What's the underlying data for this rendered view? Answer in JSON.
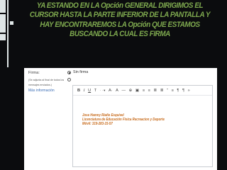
{
  "slide": {
    "title": "YA ESTANDO EN LA Opción GENERAL DIRIGIMOS EL CURSOR HASTA LA PARTE INFERIOR DE LA PANTALLA Y HAY ENCONTRAREMOS LA Opción   QUE ESTAMOS BUSCANDO LA CUAL ES FIRMA",
    "title_color": "#7faa4f",
    "background": "#0b0c0e"
  },
  "firma": {
    "label": "Firma:",
    "hint": "(Se adjunta al final de todos los mensajes enviados.)",
    "more_info": "Más información",
    "options": [
      {
        "label": "Sin firma",
        "selected": true
      },
      {
        "label": "",
        "selected": false
      }
    ]
  },
  "toolbar": {
    "buttons": [
      {
        "name": "bold-button",
        "text": "B",
        "style": "b"
      },
      {
        "name": "italic-button",
        "text": "I",
        "style": "i"
      },
      {
        "name": "underline-button",
        "text": "U",
        "style": "u"
      },
      {
        "name": "font-family-button",
        "text": "T",
        "style": ""
      },
      {
        "name": "font-size-dropdown-button",
        "text": "· · ▾",
        "style": "sm"
      },
      {
        "name": "font-size-button",
        "text": "A·",
        "style": ""
      },
      {
        "name": "text-color-button",
        "text": "A",
        "style": ""
      },
      {
        "name": "highlight-color-button",
        "text": "—",
        "style": ""
      },
      {
        "name": "link-button",
        "text": "⊕",
        "style": ""
      },
      {
        "name": "image-button",
        "text": "▣",
        "style": ""
      },
      {
        "name": "numbered-list-button",
        "text": "≡",
        "style": ""
      },
      {
        "name": "bullet-list-button",
        "text": "≡",
        "style": ""
      },
      {
        "name": "indent-less-button",
        "text": "≣",
        "style": ""
      },
      {
        "name": "indent-more-button",
        "text": "≣",
        "style": ""
      },
      {
        "name": "quote-button",
        "text": "”",
        "style": ""
      },
      {
        "name": "align-button",
        "text": "≡",
        "style": ""
      },
      {
        "name": "rtl-button",
        "text": "¶",
        "style": ""
      },
      {
        "name": "ltr-button",
        "text": "¶",
        "style": ""
      },
      {
        "name": "remove-format-button",
        "text": "»",
        "style": ""
      }
    ]
  },
  "signature": {
    "lines": [
      "Jose Hamny Riaño Esquivel",
      "Licenciatura de Educación Física Recreacion y Deporte",
      "Móvil: 319-283-15-57"
    ],
    "color": "#c76a1a"
  }
}
